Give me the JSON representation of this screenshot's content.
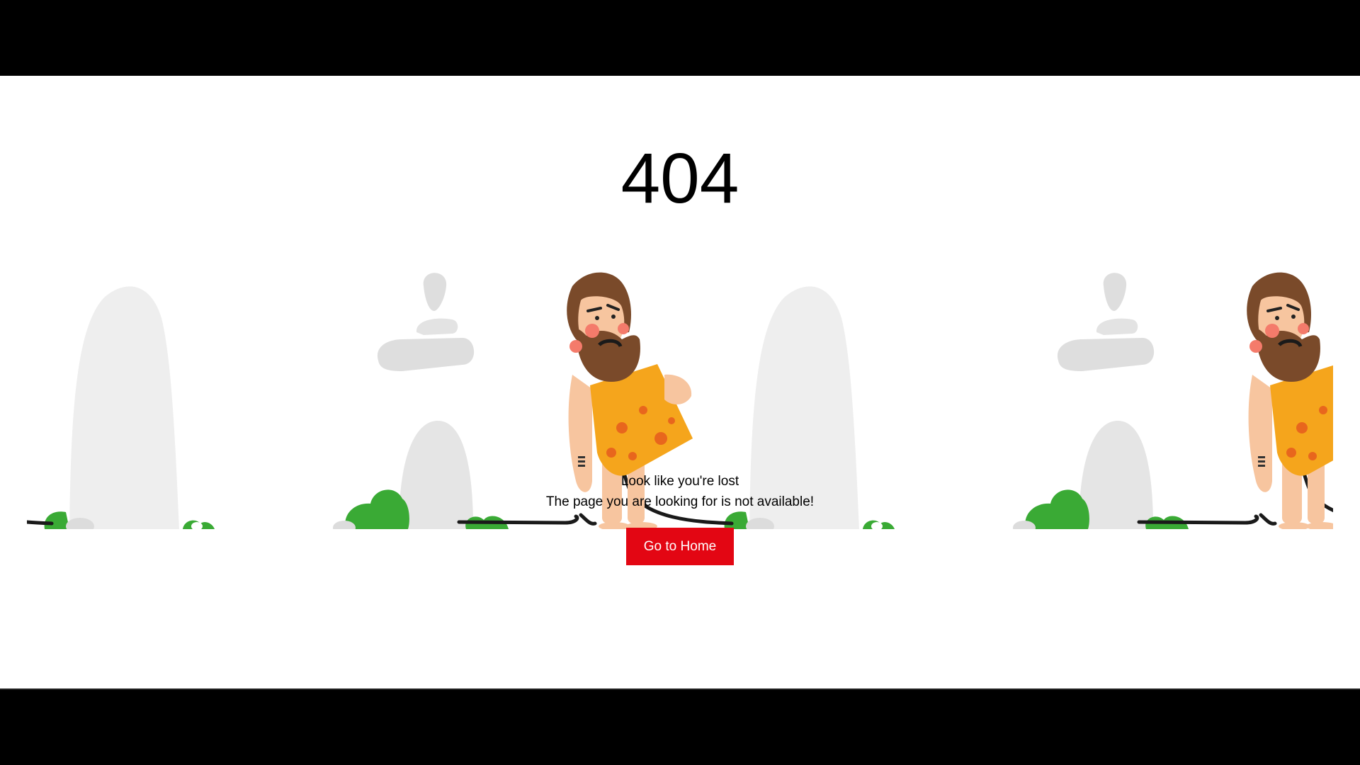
{
  "error": {
    "code": "404",
    "headline": "Look like you're lost",
    "message": "The page you are looking for is not available!",
    "home_button": "Go to Home"
  },
  "colors": {
    "accent": "#e30613",
    "rock": "#eeeeee",
    "bush": "#3aaa35",
    "tunic": "#f5a51c",
    "hair": "#7a4a2a"
  },
  "icons": [
    "caveman-illustration",
    "rock-pillar",
    "stacked-stones",
    "bush"
  ]
}
